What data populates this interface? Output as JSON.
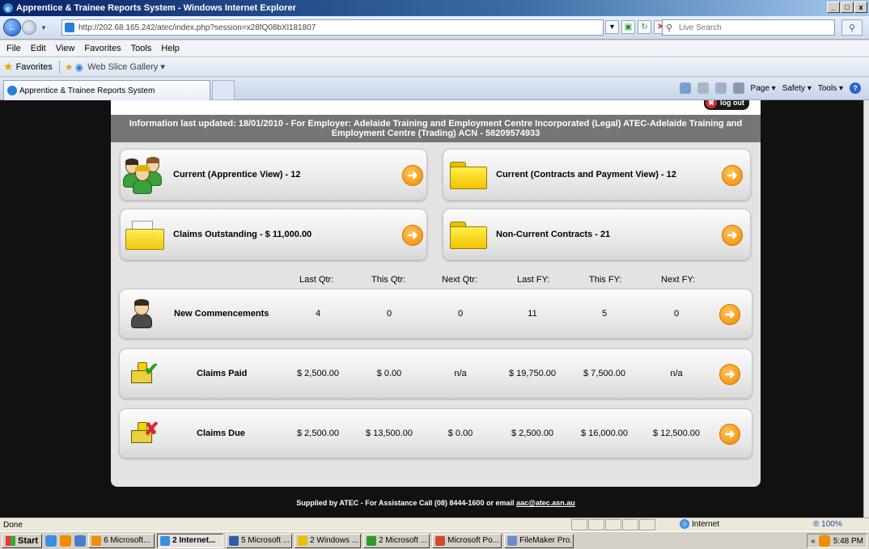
{
  "window": {
    "title": "Apprentice & Trainee Reports System - Windows Internet Explorer",
    "minimize": "_",
    "maximize": "□",
    "close": "x"
  },
  "address_bar": {
    "url": "http://202.68.165.242/atec/index.php?session=x28fQ08bXl181807",
    "search_placeholder": "Live Search"
  },
  "menu": [
    "File",
    "Edit",
    "View",
    "Favorites",
    "Tools",
    "Help"
  ],
  "favorites_bar": {
    "favorites_label": "Favorites",
    "web_slice_label": "Web Slice Gallery ▾"
  },
  "tab": {
    "title": "Apprentice & Trainee Reports System"
  },
  "command_bar": {
    "page": "Page ▾",
    "safety": "Safety ▾",
    "tools": "Tools ▾",
    "help": "?"
  },
  "page": {
    "logout_label": "log out",
    "info_line": "Information last updated: 18/01/2010 - For Employer: Adelaide Training and Employment Centre Incorporated (Legal) ATEC-Adelaide Training and Employment Centre (Trading) ACN - 58209574933",
    "cards": {
      "current_apprentice": "Current (Apprentice View) - 12",
      "current_contracts": "Current (Contracts and Payment View) - 12",
      "claims_outstanding": "Claims Outstanding - $ 11,000.00",
      "non_current": "Non-Current Contracts - 21"
    },
    "columns": [
      "Last Qtr:",
      "This Qtr:",
      "Next Qtr:",
      "Last FY:",
      "This FY:",
      "Next FY:"
    ],
    "rows": [
      {
        "label": "New Commencements",
        "values": [
          "4",
          "0",
          "0",
          "11",
          "5",
          "0"
        ]
      },
      {
        "label": "Claims Paid",
        "values": [
          "$ 2,500.00",
          "$ 0.00",
          "n/a",
          "$ 19,750.00",
          "$ 7,500.00",
          "n/a"
        ]
      },
      {
        "label": "Claims Due",
        "values": [
          "$ 2,500.00",
          "$ 13,500.00",
          "$ 0.00",
          "$ 2,500.00",
          "$ 16,000.00",
          "$ 12,500.00"
        ]
      }
    ],
    "footer_text": "Supplied by ATEC - For Assistance Call (08) 8444-1600 or email ",
    "footer_email": "aac@atec.asn.au"
  },
  "status_bar": {
    "status": "Done",
    "zone": "Internet",
    "zoom": "® 100%"
  },
  "taskbar": {
    "start": "Start",
    "buttons": [
      "6 Microsoft...",
      "2 Internet...",
      "5 Microsoft ...",
      "2 Windows ...",
      "2 Microsoft ...",
      "Microsoft Po...",
      "FileMaker Pro..."
    ],
    "clock": "5:48 PM"
  },
  "colors": {
    "accent_orange": "#f08c00",
    "info_bar": "#757575",
    "folder_yellow": "#f2c300"
  }
}
